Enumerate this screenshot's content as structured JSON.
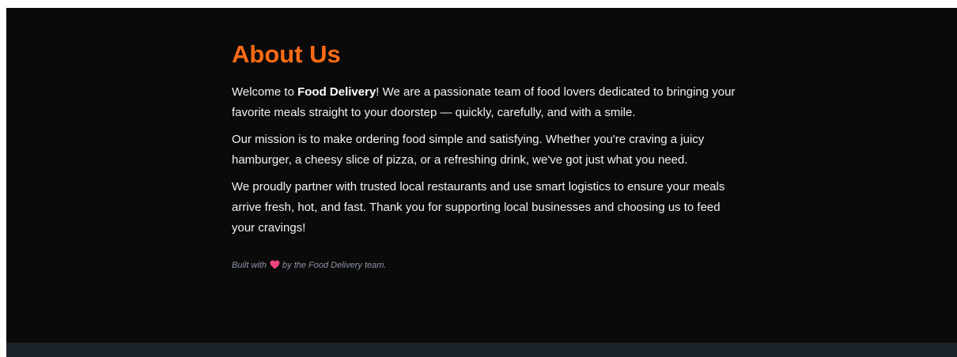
{
  "about": {
    "title": "About Us",
    "intro": {
      "before": "Welcome to ",
      "brand": "Food Delivery",
      "after": "! We are a passionate team of food lovers dedicated to bringing your favorite meals straight to your doorstep — quickly, carefully, and with a smile."
    },
    "mission": "Our mission is to make ordering food simple and satisfying. Whether you're craving a juicy hamburger, a cheesy slice of pizza, or a refreshing drink, we've got just what you need.",
    "partners": "We proudly partner with trusted local restaurants and use smart logistics to ensure your meals arrive fresh, hot, and fast. Thank you for supporting local businesses and choosing us to feed your cravings!",
    "credit": {
      "before": "Built with",
      "icon": "heart-icon",
      "after": "by the Food Delivery team."
    }
  },
  "colors": {
    "background": "#0a0a0a",
    "accent": "#ff6b13",
    "text": "#f2f2f2",
    "muted": "#8a94a6",
    "footer_strip": "#1d232b",
    "heart": "#f0457a"
  }
}
